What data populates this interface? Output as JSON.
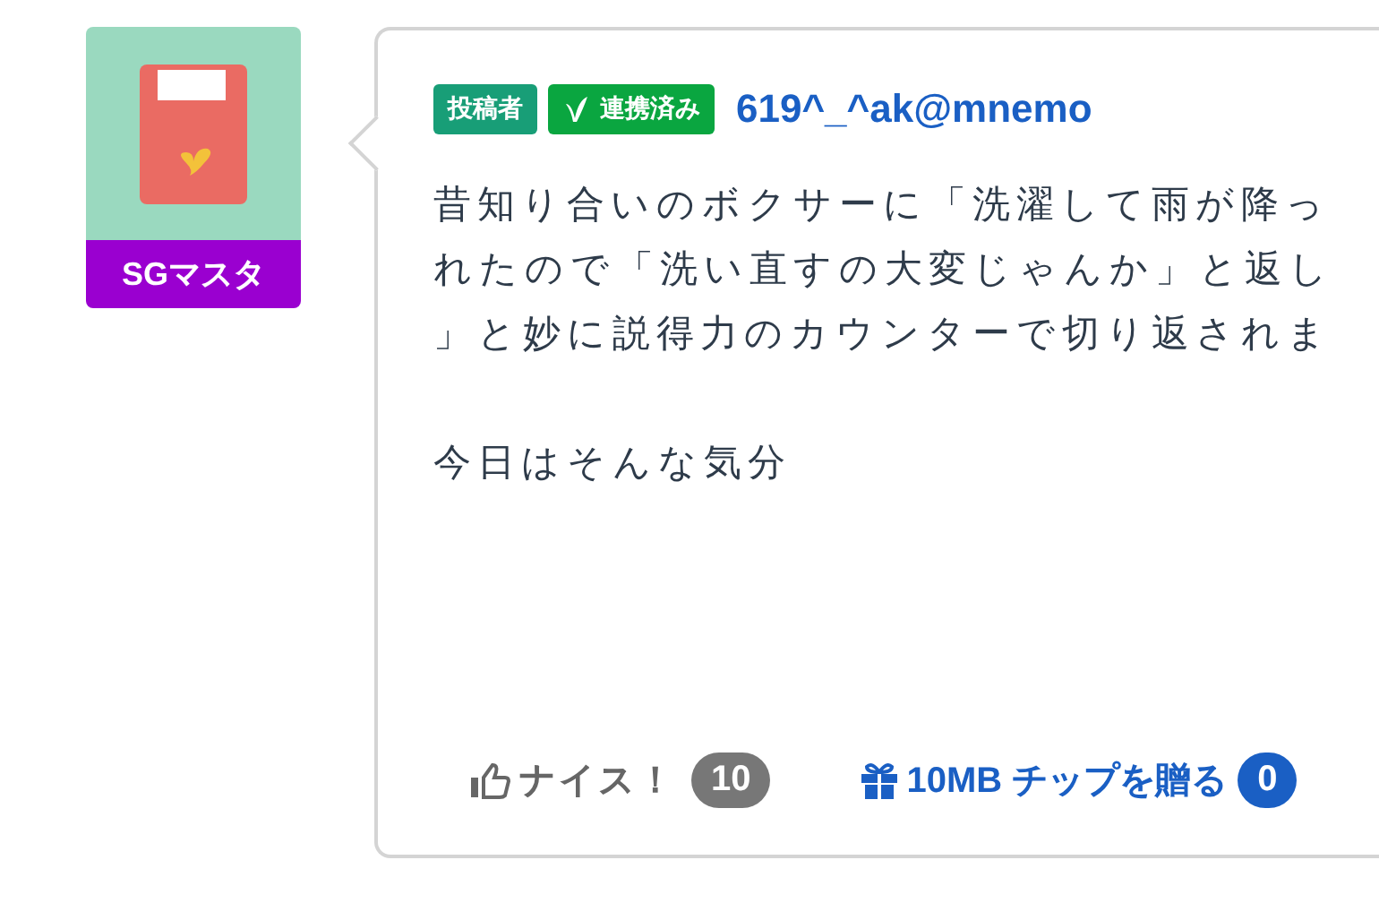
{
  "avatar": {
    "title": "SGマスタ"
  },
  "post": {
    "badges": [
      {
        "label": "投稿者",
        "kind": "role"
      },
      {
        "label": "連携済み",
        "kind": "linked"
      }
    ],
    "author": "619^_^ak@mnemo",
    "paragraphs": [
      {
        "lines": [
          "昔知り合いのボクサーに「洗濯して雨が降っ",
          "れたので「洗い直すの大変じゃんか」と返し",
          "」と妙に説得力のカウンターで切り返されま"
        ]
      },
      {
        "lines": [
          "今日はそんな気分"
        ]
      }
    ],
    "nice": {
      "label": "ナイス！",
      "count": "10"
    },
    "tip": {
      "label": "10MB チップを贈る",
      "count": "0"
    }
  }
}
